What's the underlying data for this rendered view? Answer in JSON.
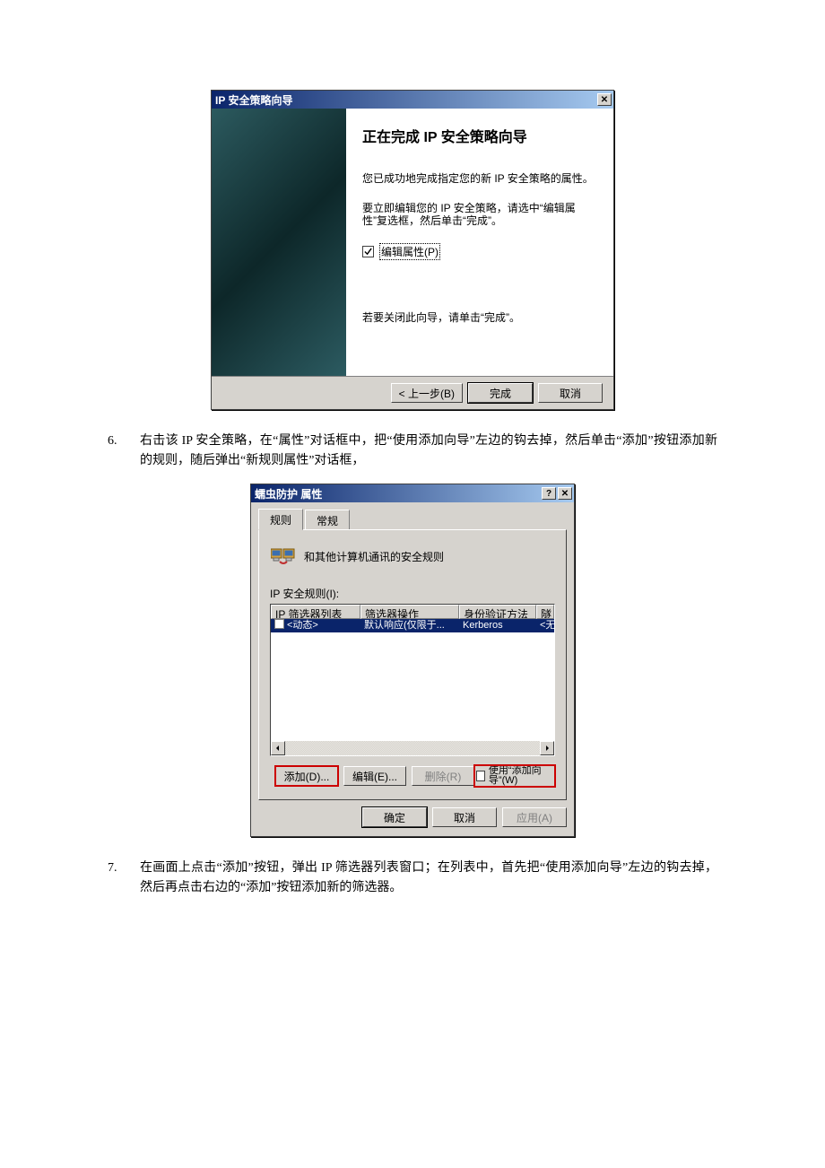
{
  "wizard": {
    "titlebar": "IP 安全策略向导",
    "heading": "正在完成 IP 安全策略向导",
    "line1": "您已成功地完成指定您的新 IP 安全策略的属性。",
    "line2": "要立即编辑您的 IP 安全策略，请选中“编辑属性”复选框，然后单击“完成”。",
    "checkbox": "编辑属性(P)",
    "close_hint": "若要关闭此向导，请单击“完成”。",
    "back": "< 上一步(B)",
    "finish": "完成",
    "cancel": "取消"
  },
  "doc": {
    "item6_num": "6.",
    "item6_text": "右击该 IP 安全策略，在“属性”对话框中，把“使用添加向导”左边的钩去掉，然后单击“添加”按钮添加新的规则，随后弹出“新规则属性”对话框，",
    "item7_num": "7.",
    "item7_text": "在画面上点击“添加”按钮，弹出 IP 筛选器列表窗口；在列表中，首先把“使用添加向导”左边的钩去掉，然后再点击右边的“添加”按钮添加新的筛选器。"
  },
  "props": {
    "titlebar": "蠕虫防护 属性",
    "tab_rules": "规则",
    "tab_general": "常规",
    "heading": "和其他计算机通讯的安全规则",
    "list_label": "IP 安全规则(I):",
    "cols": {
      "c1": "IP 筛选器列表",
      "c2": "筛选器操作",
      "c3": "身份验证方法",
      "c4": "隧"
    },
    "row": {
      "c1": "<动态>",
      "c2": "默认响应(仅限于...",
      "c3": "Kerberos",
      "c4": "<无"
    },
    "btn_add": "添加(D)...",
    "btn_edit": "编辑(E)...",
    "btn_remove": "删除(R)",
    "use_wizard": "使用“添加向导”(W)",
    "ok": "确定",
    "cancel": "取消",
    "apply": "应用(A)"
  }
}
